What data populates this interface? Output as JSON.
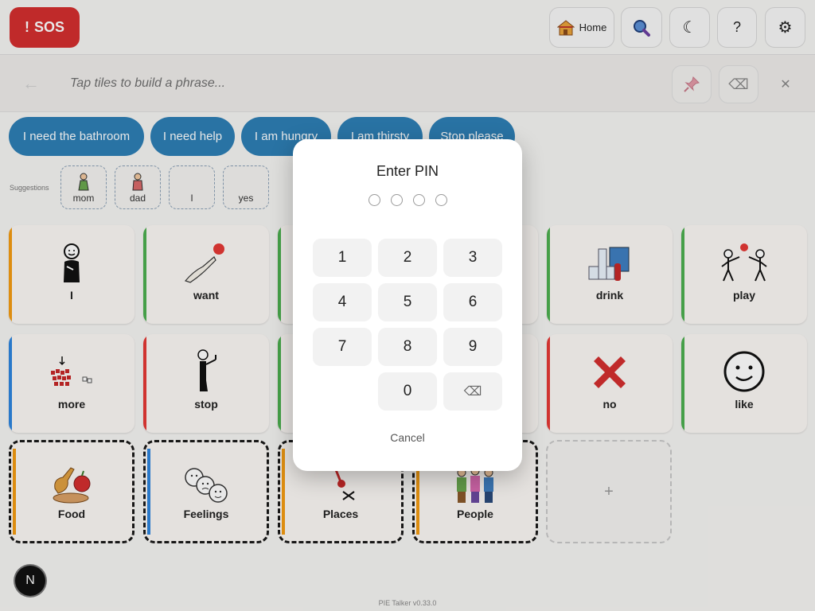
{
  "header": {
    "sos_icon": "!",
    "sos_label": "SOS",
    "home_label": "Home",
    "moon_glyph": "☾",
    "help_glyph": "?",
    "settings_glyph": "⚙"
  },
  "phrase_bar": {
    "placeholder": "Tap tiles to build a phrase...",
    "back_glyph": "←",
    "backspace_glyph": "⌫",
    "clear_glyph": "✕"
  },
  "quick_phrases": [
    "I need the bathroom",
    "I need help",
    "I am hungry",
    "I am thirsty",
    "Stop please"
  ],
  "suggestions": {
    "label": "Suggestions",
    "items": [
      "mom",
      "dad",
      "I",
      "yes"
    ]
  },
  "tiles": [
    "I",
    "want",
    "drink",
    "play",
    "more",
    "stop",
    "no",
    "like"
  ],
  "folders": [
    "Food",
    "Feelings",
    "Places",
    "People"
  ],
  "add_tile_glyph": "+",
  "avatar_letter": "N",
  "version": "PIE Talker v0.33.0",
  "pin_dialog": {
    "title": "Enter PIN",
    "keys": [
      "1",
      "2",
      "3",
      "4",
      "5",
      "6",
      "7",
      "8",
      "9",
      "0"
    ],
    "backspace_glyph": "⌫",
    "cancel_label": "Cancel"
  },
  "colors": {
    "sos": "#d32f2f",
    "quick_phrase": "#2e7fb5",
    "tile_orange": "#f39c12",
    "tile_green": "#4caf50",
    "tile_blue": "#2e86de",
    "tile_red": "#e53935"
  }
}
